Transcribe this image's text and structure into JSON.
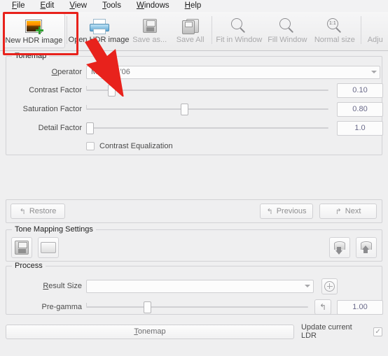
{
  "menubar": {
    "items": [
      {
        "label": "File",
        "mnemonic": "F"
      },
      {
        "label": "Edit",
        "mnemonic": "E"
      },
      {
        "label": "View",
        "mnemonic": "V"
      },
      {
        "label": "Tools",
        "mnemonic": "T"
      },
      {
        "label": "Windows",
        "mnemonic": "W"
      },
      {
        "label": "Help",
        "mnemonic": "H"
      }
    ]
  },
  "toolbar": {
    "buttons": [
      {
        "label": "New HDR image",
        "icon": "new-hdr-image-icon",
        "enabled": true,
        "highlighted": true
      },
      {
        "label": "Open HDR image",
        "icon": "open-hdr-image-icon",
        "enabled": true
      },
      {
        "label": "Save as...",
        "icon": "save-as-icon",
        "enabled": false
      },
      {
        "label": "Save All",
        "icon": "save-all-icon",
        "enabled": false
      },
      {
        "label": "Fit in Window",
        "icon": "fit-in-window-icon",
        "enabled": false
      },
      {
        "label": "Fill Window",
        "icon": "fill-window-icon",
        "enabled": false
      },
      {
        "label": "Normal size",
        "icon": "normal-size-icon",
        "enabled": false,
        "badge": "1:1"
      },
      {
        "label": "Adju",
        "icon": "adjust-levels-icon",
        "enabled": false,
        "clipped": true
      }
    ]
  },
  "tonemap": {
    "legend": "Tonemap",
    "operator": {
      "label": "Operator",
      "mnemonic": "O",
      "value": "Mantiuk '06"
    },
    "sliders": [
      {
        "label": "Contrast Factor",
        "value": "0.10",
        "handle_pct": 9
      },
      {
        "label": "Saturation Factor",
        "value": "0.80",
        "handle_pct": 39
      },
      {
        "label": "Detail Factor",
        "value": "1.0",
        "handle_pct": 0
      }
    ],
    "checkbox": {
      "label": "Contrast Equalization",
      "checked": false
    }
  },
  "navigation": {
    "restore": {
      "label": "Restore",
      "icon": "undo-arrow-icon"
    },
    "previous": {
      "label": "Previous",
      "icon": "back-arrow-icon"
    },
    "next": {
      "label": "Next",
      "icon": "forward-arrow-icon"
    }
  },
  "settings": {
    "legend": "Tone Mapping Settings",
    "save_icon": "floppy-save-icon",
    "load_icon": "open-folder-icon",
    "import_icon": "database-import-icon",
    "export_icon": "database-export-icon"
  },
  "process": {
    "legend": "Process",
    "result_size": {
      "label": "Result Size",
      "mnemonic": "R",
      "value": ""
    },
    "size_button_icon": "zoom-plus-icon",
    "pre_gamma": {
      "label": "Pre-gamma",
      "value": "1.00",
      "handle_pct": 26,
      "reset_icon": "reset-arrow-icon"
    },
    "tonemap_button": {
      "label": "Tonemap",
      "mnemonic": "T"
    },
    "update_ldr": {
      "label": "Update current LDR",
      "checked": true,
      "check_glyph": "✓"
    }
  },
  "annotation": {
    "color": "#e8221c",
    "box_target": "new-hdr-image-button",
    "arrow_points_to": "new-hdr-image-button"
  }
}
